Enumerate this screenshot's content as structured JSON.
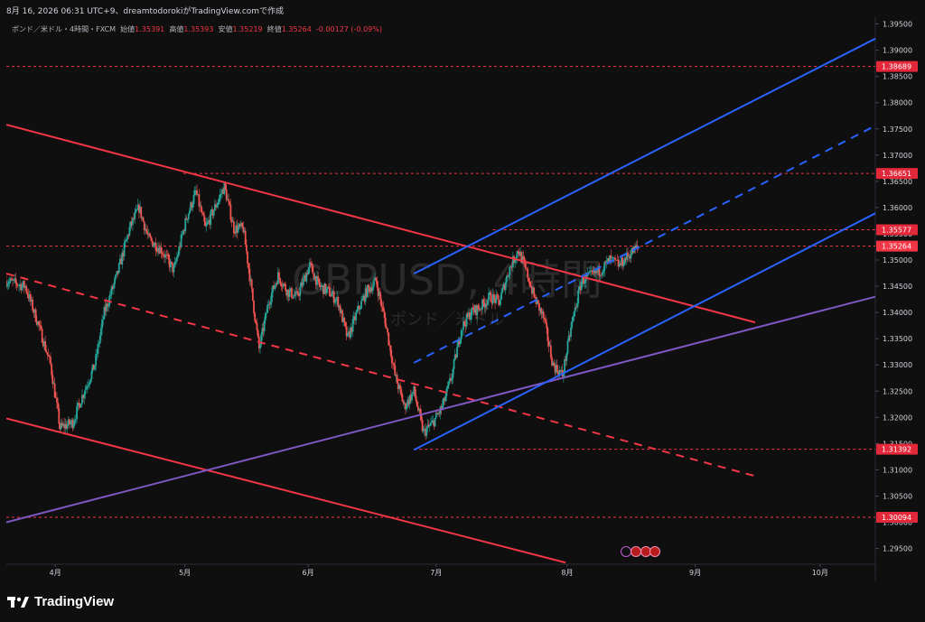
{
  "header": {
    "text": "8月 16, 2026 06:31 UTC+9、dreamtodorokiがTradingView.comで作成"
  },
  "legend": {
    "symbol": "ポンド／米ドル・4時間・FXCM",
    "open_label": "始値",
    "open": "1.35391",
    "high_label": "高値",
    "high": "1.35393",
    "low_label": "安値",
    "low": "1.35219",
    "close_label": "終値",
    "close": "1.35264",
    "change": "-0.00127 (-0.09%)"
  },
  "watermark": {
    "line1": "GBPUSD, 4時間",
    "line2": "ポンド／米ドル"
  },
  "footer": {
    "brand": "TradingView"
  },
  "colors": {
    "background": "#0f0f0f",
    "bull": "#26a69a",
    "bear": "#ef5350",
    "red_line": "#f23645",
    "blue_line": "#2962ff",
    "purple_line": "#7e57c2"
  },
  "chart_data": {
    "type": "candlestick",
    "symbol": "GBPUSD",
    "timeframe": "4時間",
    "y_axis_ticks": [
      "1.39500",
      "1.39000",
      "1.38500",
      "1.38000",
      "1.37500",
      "1.37000",
      "1.36500",
      "1.36000",
      "1.35500",
      "1.35000",
      "1.34500",
      "1.34000",
      "1.33500",
      "1.33000",
      "1.32500",
      "1.32000",
      "1.31500",
      "1.31000",
      "1.30500",
      "1.30000",
      "1.29500"
    ],
    "ylim": [
      1.292,
      1.3963
    ],
    "x_axis_labels": [
      "4月",
      "5月",
      "6月",
      "7月",
      "8月",
      "9月",
      "10月"
    ],
    "x_tick_times": [
      0.95,
      5.05,
      8.95,
      13.0,
      17.15,
      21.2,
      25.15
    ],
    "xlim": [
      -0.6,
      26.9
    ],
    "price_tags": [
      {
        "label": "1.38689",
        "value": 1.38689
      },
      {
        "label": "1.36651",
        "value": 1.36651
      },
      {
        "label": "1.35577",
        "value": 1.35577
      },
      {
        "label": "1.35264",
        "value": 1.35264,
        "current": true
      },
      {
        "label": "1.31392",
        "value": 1.31392
      },
      {
        "label": "1.30094",
        "value": 1.30094
      }
    ],
    "price_path": [
      [
        -0.6,
        1.346
      ],
      [
        0.0,
        1.345
      ],
      [
        0.4,
        1.338
      ],
      [
        0.8,
        1.33
      ],
      [
        1.1,
        1.318
      ],
      [
        1.5,
        1.319
      ],
      [
        1.8,
        1.324
      ],
      [
        2.2,
        1.33
      ],
      [
        2.5,
        1.34
      ],
      [
        2.9,
        1.347
      ],
      [
        3.3,
        1.356
      ],
      [
        3.6,
        1.36
      ],
      [
        3.9,
        1.354
      ],
      [
        4.3,
        1.352
      ],
      [
        4.7,
        1.348
      ],
      [
        5.1,
        1.358
      ],
      [
        5.4,
        1.363
      ],
      [
        5.7,
        1.356
      ],
      [
        6.0,
        1.36
      ],
      [
        6.3,
        1.364
      ],
      [
        6.6,
        1.356
      ],
      [
        6.9,
        1.356
      ],
      [
        7.1,
        1.347
      ],
      [
        7.4,
        1.333
      ],
      [
        7.7,
        1.342
      ],
      [
        8.0,
        1.347
      ],
      [
        8.3,
        1.344
      ],
      [
        8.6,
        1.343
      ],
      [
        9.0,
        1.349
      ],
      [
        9.3,
        1.345
      ],
      [
        9.6,
        1.344
      ],
      [
        9.9,
        1.342
      ],
      [
        10.2,
        1.335
      ],
      [
        10.5,
        1.34
      ],
      [
        10.8,
        1.344
      ],
      [
        11.1,
        1.346
      ],
      [
        11.4,
        1.338
      ],
      [
        11.7,
        1.328
      ],
      [
        12.0,
        1.322
      ],
      [
        12.3,
        1.325
      ],
      [
        12.6,
        1.317
      ],
      [
        12.9,
        1.319
      ],
      [
        13.2,
        1.322
      ],
      [
        13.5,
        1.328
      ],
      [
        13.8,
        1.337
      ],
      [
        14.1,
        1.34
      ],
      [
        14.4,
        1.341
      ],
      [
        14.7,
        1.343
      ],
      [
        15.0,
        1.342
      ],
      [
        15.3,
        1.348
      ],
      [
        15.6,
        1.352
      ],
      [
        15.9,
        1.347
      ],
      [
        16.1,
        1.343
      ],
      [
        16.4,
        1.339
      ],
      [
        16.7,
        1.33
      ],
      [
        17.0,
        1.328
      ],
      [
        17.3,
        1.338
      ],
      [
        17.6,
        1.346
      ],
      [
        17.9,
        1.347
      ],
      [
        18.2,
        1.348
      ],
      [
        18.5,
        1.35
      ],
      [
        18.8,
        1.349
      ],
      [
        19.1,
        1.351
      ],
      [
        19.4,
        1.3526
      ]
    ],
    "trendlines": [
      {
        "style": "solid",
        "color": "red",
        "from": [
          -0.6,
          1.3758
        ],
        "to": [
          23.1,
          1.3381
        ]
      },
      {
        "style": "dashed",
        "color": "red",
        "from": [
          -0.6,
          1.3474
        ],
        "to": [
          23.1,
          1.3088
        ]
      },
      {
        "style": "solid",
        "color": "red",
        "from": [
          -0.6,
          1.3198
        ],
        "to": [
          17.1,
          1.2923
        ]
      },
      {
        "style": "solid",
        "color": "purple",
        "from": [
          -0.6,
          1.3
        ],
        "to": [
          26.9,
          1.343
        ]
      },
      {
        "style": "solid",
        "color": "blue",
        "from": [
          12.3,
          1.3138
        ],
        "to": [
          26.9,
          1.3589
        ]
      },
      {
        "style": "solid",
        "color": "blue",
        "from": [
          12.3,
          1.3474
        ],
        "to": [
          26.9,
          1.3922
        ]
      },
      {
        "style": "dashed",
        "color": "blue",
        "from": [
          12.3,
          1.3304
        ],
        "to": [
          26.9,
          1.3756
        ]
      }
    ],
    "horizontal_levels": [
      {
        "value": 1.38689,
        "from": -0.6
      },
      {
        "value": 1.36651,
        "from": 5.0
      },
      {
        "value": 1.35577,
        "from": 14.8
      },
      {
        "value": 1.35264,
        "from": -0.6
      },
      {
        "value": 1.31392,
        "from": 12.3
      },
      {
        "value": 1.30094,
        "from": -0.6
      }
    ]
  }
}
